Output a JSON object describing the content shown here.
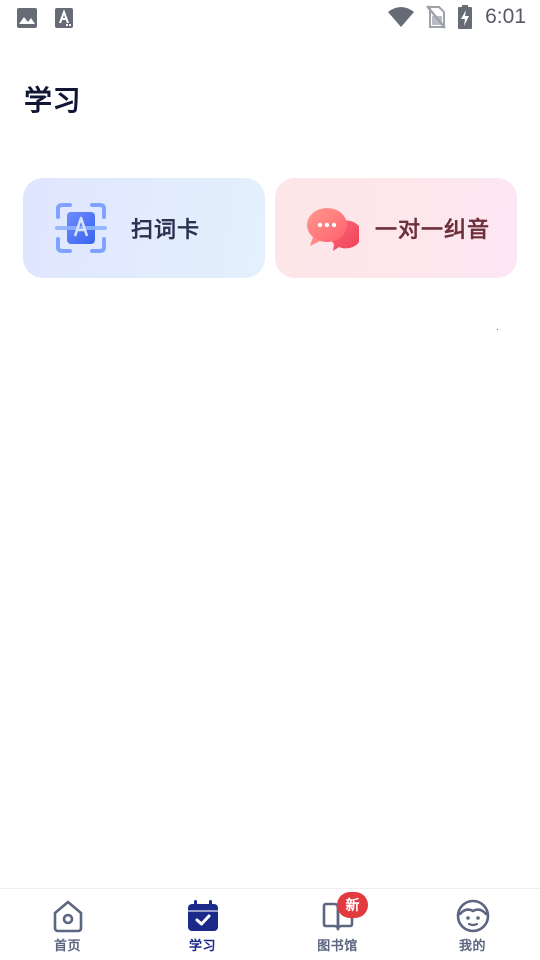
{
  "status_bar": {
    "time": "6:01",
    "left_icons": [
      "image-icon",
      "text-a-icon"
    ],
    "right_icons": [
      "wifi-icon",
      "no-sim-icon",
      "battery-charging-icon"
    ]
  },
  "page": {
    "title": "学习"
  },
  "cards": [
    {
      "label": "扫词卡",
      "icon": "scan-text-icon"
    },
    {
      "label": "一对一纠音",
      "icon": "chat-bubbles-icon"
    }
  ],
  "bottom_nav": {
    "items": [
      {
        "label": "首页",
        "icon": "home-icon",
        "active": false
      },
      {
        "label": "学习",
        "icon": "calendar-check-icon",
        "active": true
      },
      {
        "label": "图书馆",
        "icon": "book-icon",
        "active": false,
        "badge": "新"
      },
      {
        "label": "我的",
        "icon": "profile-face-icon",
        "active": false
      }
    ]
  },
  "colors": {
    "accent": "#1b2a8a",
    "inactive_nav": "#5d6680",
    "badge": "#e23a3f",
    "title": "#101634"
  }
}
